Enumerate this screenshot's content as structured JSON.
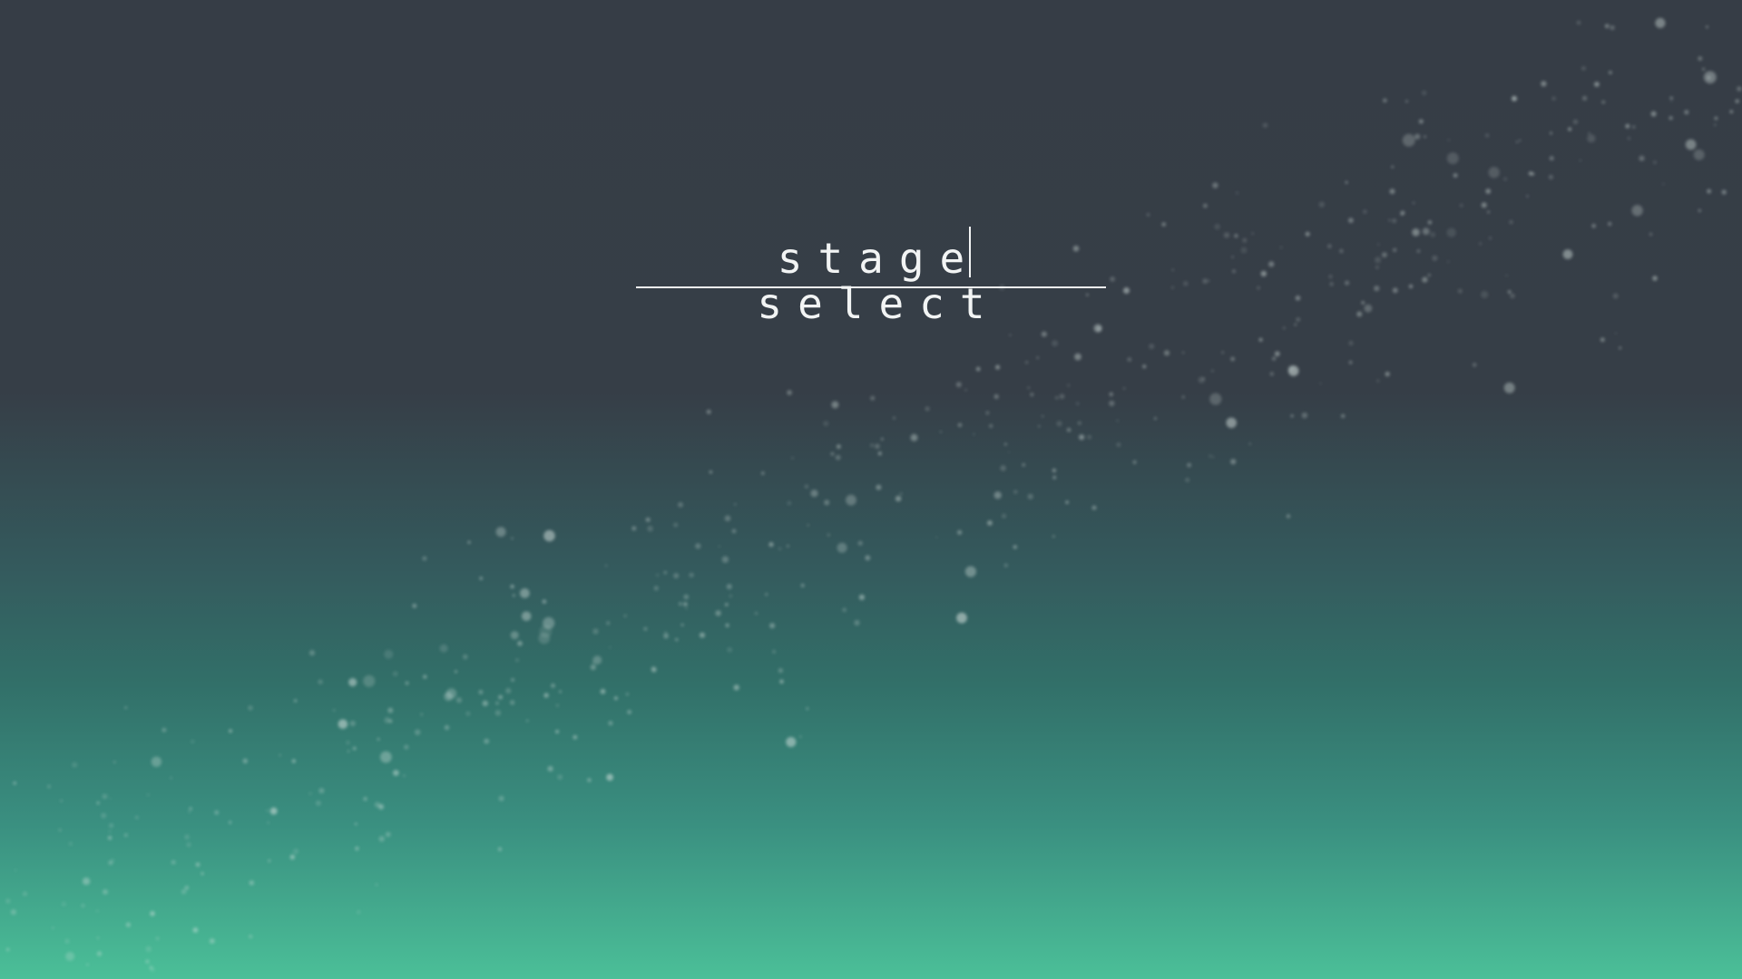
{
  "screen": {
    "title": "stage select"
  },
  "colors": {
    "background_top": "#363d46",
    "background_bottom": "#4bbf98",
    "text": "#f2f4f4",
    "particle": "#d8e4e0"
  }
}
